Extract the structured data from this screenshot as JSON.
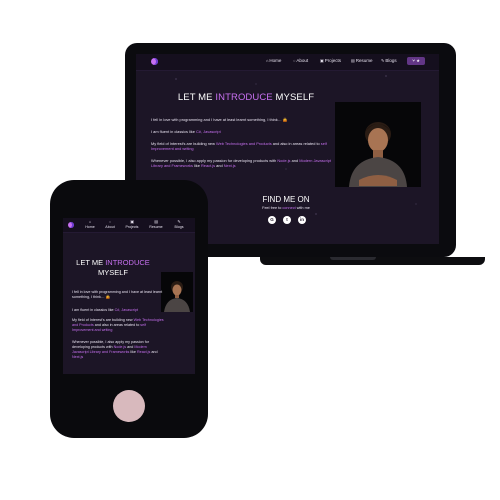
{
  "nav": {
    "items": [
      {
        "icon": "home-icon",
        "glyph": "⌂",
        "label": "Home"
      },
      {
        "icon": "user-icon",
        "glyph": "◌",
        "label": "About"
      },
      {
        "icon": "projects-icon",
        "glyph": "▣",
        "label": "Projects"
      },
      {
        "icon": "resume-icon",
        "glyph": "▤",
        "label": "Resume"
      },
      {
        "icon": "blogs-icon",
        "glyph": "✎",
        "label": "Blogs"
      }
    ],
    "fork_icon": "fork-star-icon",
    "fork_glyph": "⑂ ★"
  },
  "intro": {
    "title_prefix": "LET ME",
    "title_accent": "INTRODUCE",
    "title_suffix": "MYSELF",
    "p1": "I fell in love with programming and I have at least learnt something, I think… 🤷",
    "p2_prefix": "I am fluent in classics like",
    "p2_accent": "C#, Javascript",
    "p3_prefix": "My field of Interest's are building new",
    "p3_accent1": "Web Technologies and Products",
    "p3_mid": "and also in areas related to",
    "p3_accent2": "self Improvement and writing",
    "p4_prefix": "Whenever possible, I also apply my passion for developing products with",
    "p4_accent1": "Node.js",
    "p4_and": "and",
    "p4_accent2": "Modern Javascript Library and Frameworks",
    "p4_like": "like",
    "p4_accent3": "React.js",
    "p4_and2": "and",
    "p4_accent4": "Next.js"
  },
  "find": {
    "title": "FIND ME ON",
    "connect_prefix": "Feel free to",
    "connect_accent": "connect",
    "connect_suffix": "with me",
    "socials": [
      {
        "icon": "github-icon",
        "glyph": "G"
      },
      {
        "icon": "twitter-icon",
        "glyph": "t"
      },
      {
        "icon": "linkedin-icon",
        "glyph": "in"
      }
    ]
  },
  "colors": {
    "accent": "#c770f0",
    "background": "#1c1526",
    "navbar": "#150f1e",
    "home_button": "#d8b9bd"
  }
}
